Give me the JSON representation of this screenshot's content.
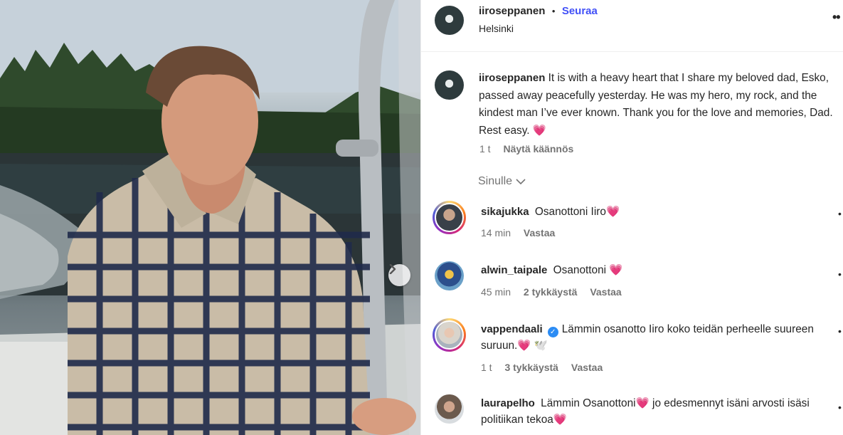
{
  "post": {
    "author": "iiroseppanen",
    "separator": "•",
    "follow_label": "Seuraa",
    "location": "Helsinki",
    "more_icon": "more-options-icon",
    "caption_text": "It is with a heavy heart that I share my beloved dad, Esko, passed away peacefully yesterday. He was my hero, my rock, and the kindest man I’ve ever known. Thank you for the love and memories, Dad. Rest easy.",
    "caption_emoji": "💗",
    "caption_time": "1 t",
    "translate_label": "Näytä käännös"
  },
  "sort": {
    "label": "Sinulle"
  },
  "comments": [
    {
      "user": "sikajukka",
      "text": "Osanottoni Iiro",
      "emoji": "💗",
      "time": "14 min",
      "likes": "",
      "reply": "Vastaa",
      "story_ring": true
    },
    {
      "user": "alwin_taipale",
      "text": "Osanottoni ",
      "emoji": "💗",
      "time": "45 min",
      "likes": "2 tykkäystä",
      "reply": "Vastaa",
      "story_ring": false
    },
    {
      "user": "vappendaali",
      "verified": true,
      "text": "Lämmin osanotto Iiro koko teidän perheelle suureen suruun.",
      "emoji": "💗 🕊️",
      "time": "1 t",
      "likes": "3 tykkäystä",
      "reply": "Vastaa",
      "story_ring": true
    },
    {
      "user": "laurapelho",
      "text": "Lämmin Osanottoni",
      "emoji": "💗",
      "text2": "jo edesmennyt isäni arvosti isäsi politiikan tekoa",
      "emoji2": "💗",
      "story_ring": false
    }
  ],
  "colors": {
    "follow": "#4150f7",
    "heart": "#e8245c",
    "verified": "#2c8cf4",
    "muted": "#737373"
  }
}
